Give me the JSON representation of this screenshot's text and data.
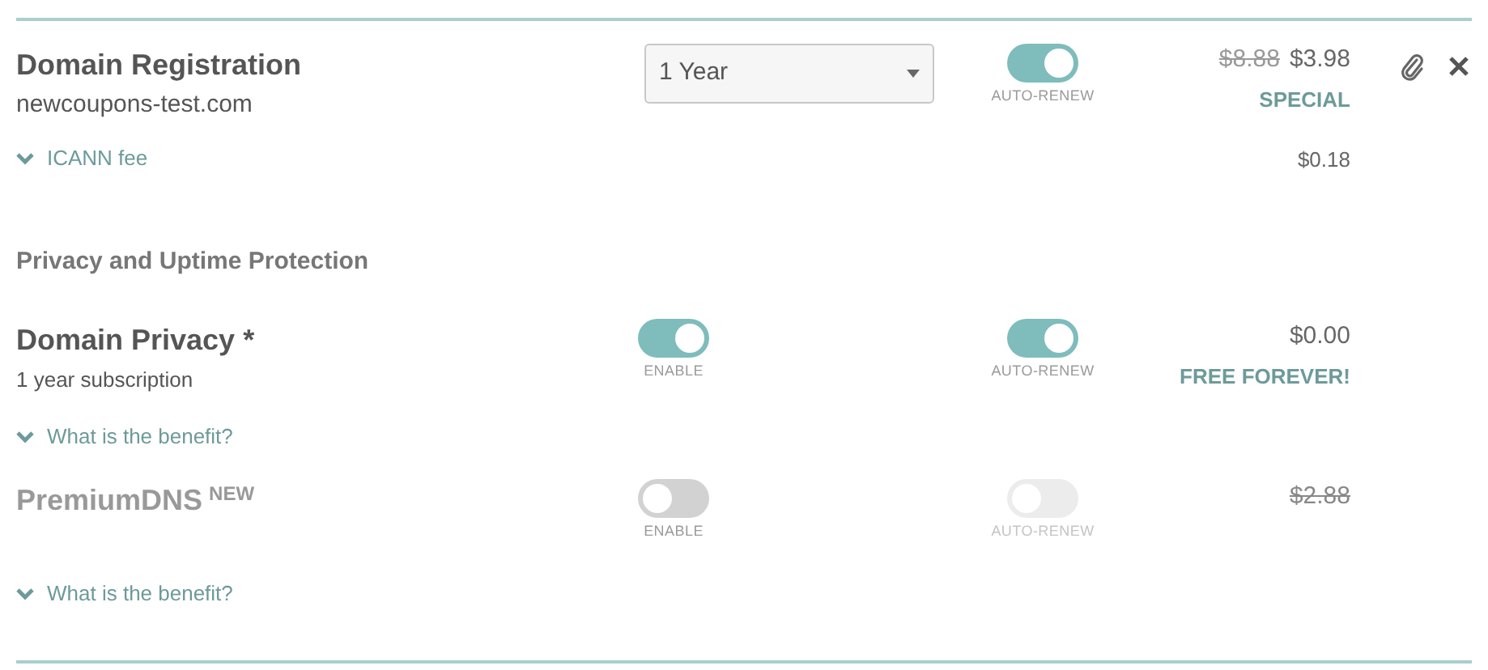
{
  "registration": {
    "title": "Domain Registration",
    "domain": "newcoupons-test.com",
    "fee_link": {
      "label": "ICANN fee",
      "expanded": false
    },
    "term": {
      "value": "1 Year"
    },
    "auto_renew": {
      "label": "AUTO-RENEW",
      "on": true
    },
    "old_price": "$8.88",
    "price": "$3.98",
    "price_note": "SPECIAL",
    "fee_price": "$0.18"
  },
  "section_title": "Privacy and Uptime Protection",
  "products": [
    {
      "name": "Domain Privacy *",
      "subtitle": "1 year subscription",
      "enable": {
        "label": "ENABLE",
        "on": true
      },
      "auto_renew": {
        "label": "AUTO-RENEW",
        "on": true,
        "disabled": false
      },
      "price": "$0.00",
      "price_struck": false,
      "note": "FREE FOREVER!",
      "benefit_link": {
        "label": "What is the benefit?",
        "expanded": false
      }
    },
    {
      "name": "PremiumDNS",
      "badge": "NEW",
      "enable": {
        "label": "ENABLE",
        "on": false
      },
      "auto_renew": {
        "label": "AUTO-RENEW",
        "on": false,
        "disabled": true
      },
      "price": "$2.88",
      "price_struck": true,
      "benefit_link": {
        "label": "What is the benefit?",
        "expanded": false
      }
    }
  ]
}
